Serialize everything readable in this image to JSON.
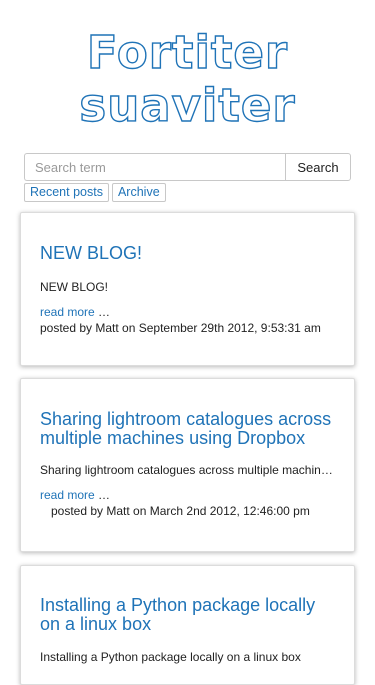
{
  "site": {
    "title_line1": "Fortiter",
    "title_line2": "suaviter"
  },
  "search": {
    "placeholder": "Search term",
    "button_label": "Search"
  },
  "nav": {
    "recent_posts": "Recent posts",
    "archive": "Archive"
  },
  "posts": [
    {
      "title": "NEW BLOG!",
      "excerpt": "NEW BLOG!",
      "read_more": "read more",
      "ellipsis": "…",
      "meta": "posted by Matt on September 29th 2012, 9:53:31 am"
    },
    {
      "title": "Sharing lightroom catalogues across multiple machines using Dropbox",
      "excerpt": "Sharing lightroom catalogues across multiple machines using Dropbox",
      "read_more": "read more",
      "ellipsis": "…",
      "meta": "posted by Matt on March 2nd 2012, 12:46:00 pm"
    },
    {
      "title": "Installing a Python package locally on a linux box",
      "excerpt": "Installing a Python package locally on a linux box"
    }
  ],
  "colors": {
    "link": "#1f73b7",
    "text": "#222222",
    "border": "#c8c8c8"
  }
}
